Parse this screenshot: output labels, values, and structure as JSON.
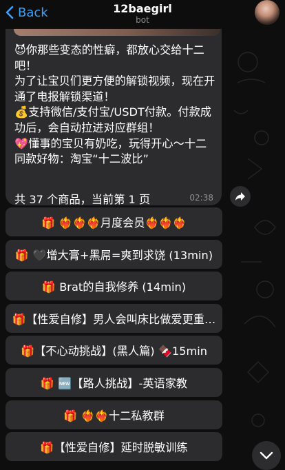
{
  "header": {
    "back_label": "Back",
    "title": "12baegirl",
    "subtitle": "bot"
  },
  "message": {
    "text": "😈你那些变态的性癖，都放心交给十二吧！\n为了让宝贝们更方便的解锁视频，现在开通了电报解锁渠道！\n💰支持微信/支付宝/USDT付款。付款成功后，会自动拉进对应群组！\n💖懂事的宝贝有奶吃，玩得开心～十二同款好物：淘宝“十二波比”",
    "footer": "共 37 个商品，当前第 1 页",
    "time": "02:38"
  },
  "keyboard": [
    "🎁 ❤️‍🔥❤️‍🔥❤️‍🔥月度会员❤️‍🔥❤️‍🔥❤️‍🔥",
    "🎁 🖤增大膏+黑屌=爽到求饶 (13min)",
    "🎁 Brat的自我修养 (14min)",
    "🎁【性爱自修】男人会叫床比做爱更重…",
    "🎁【不心动挑战】(黑人篇) 🍫15min",
    "🎁 🆕【路人挑战】-英语家教",
    "🎁 ❤️‍🔥❤️‍🔥十二私教群",
    "🎁【性爱自修】延时脱敏训练"
  ],
  "colors": {
    "accent": "#3aa2ff",
    "bubble": "#2c2c2e",
    "background": "#0e0e0e",
    "muted": "#8e8e93"
  },
  "icons": [
    "chevron-left-icon",
    "share-arrow-icon",
    "chevron-down-icon"
  ]
}
